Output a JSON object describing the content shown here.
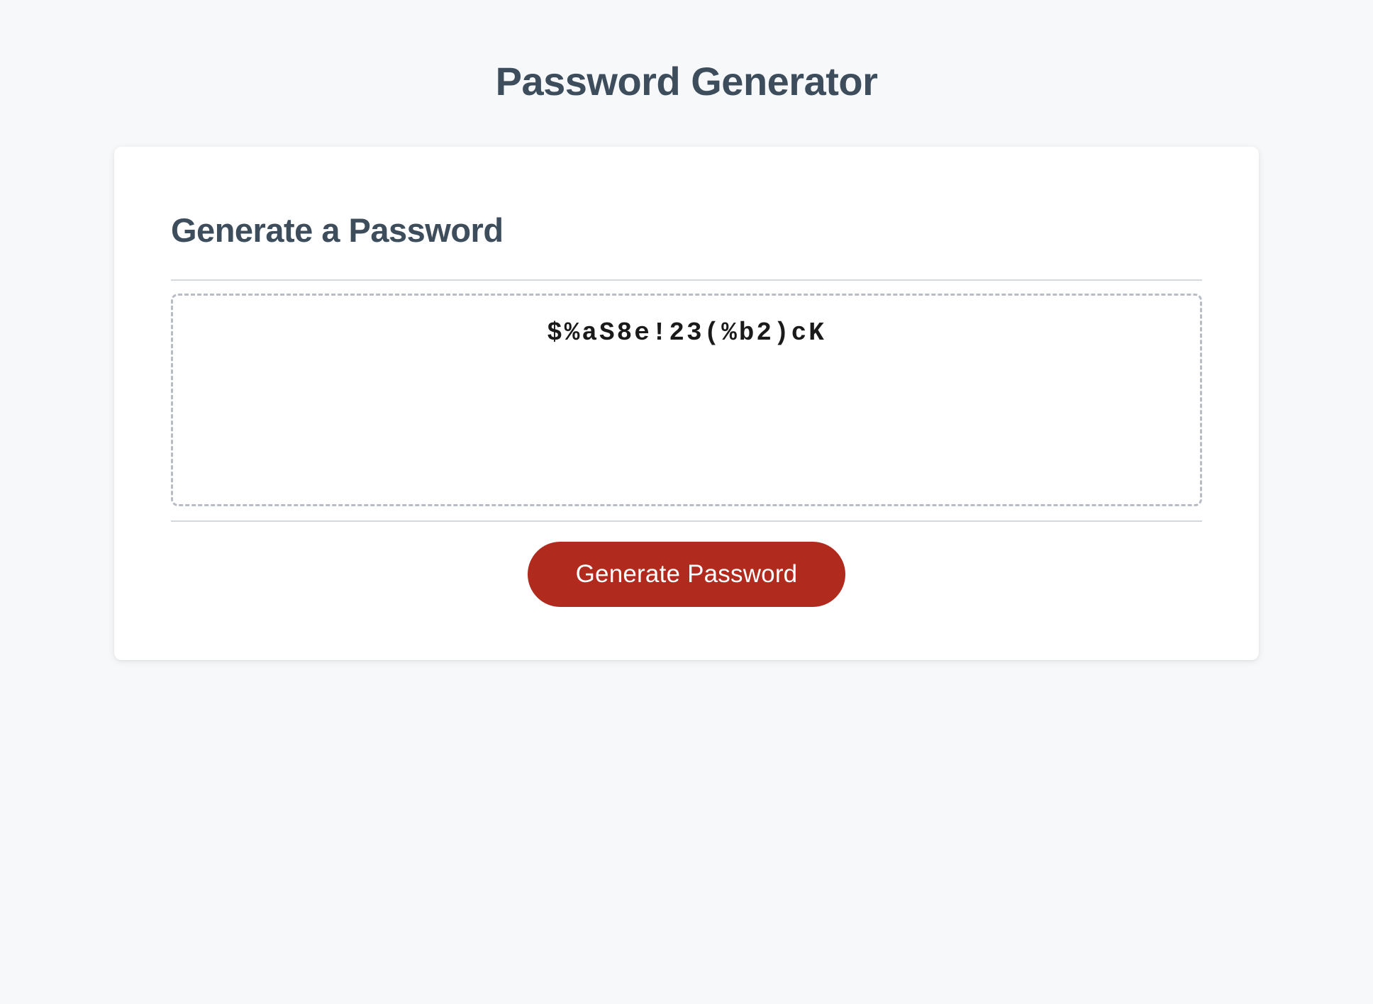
{
  "page": {
    "title": "Password Generator"
  },
  "card": {
    "heading": "Generate a Password",
    "password_value": "$%aS8e!23(%b2)cK",
    "button_label": "Generate Password"
  }
}
